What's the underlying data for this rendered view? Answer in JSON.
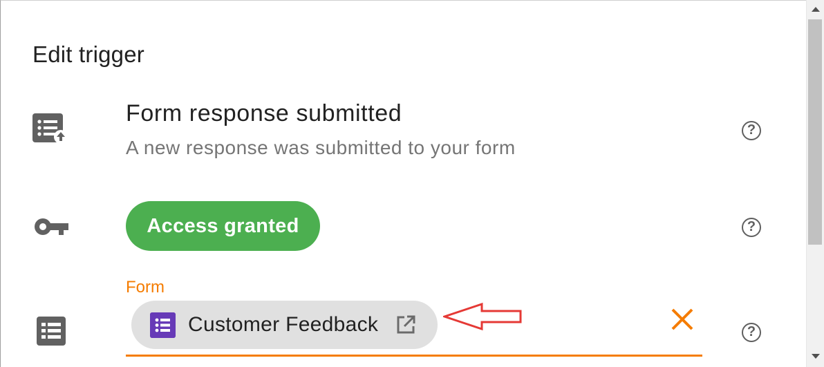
{
  "dialog": {
    "title": "Edit trigger"
  },
  "trigger": {
    "icon": "form-response-icon",
    "name": "Form response submitted",
    "description": "A new response was submitted to your form",
    "help_icon": "help-circle-icon"
  },
  "access": {
    "icon": "key-icon",
    "label": "Access granted",
    "color": "#4caf50",
    "help_icon": "help-circle-icon"
  },
  "form_field": {
    "icon": "list-icon",
    "label": "Form",
    "accent_color": "#f57c00",
    "selected_value": "Customer Feedback",
    "chip_icon": "google-forms-icon",
    "chip_icon_color": "#673ab7",
    "open_icon": "open-in-new-icon",
    "clear_icon": "close-icon",
    "help_icon": "help-circle-icon"
  },
  "help_glyph": "?",
  "annotation": {
    "arrow_color": "#e53935"
  }
}
